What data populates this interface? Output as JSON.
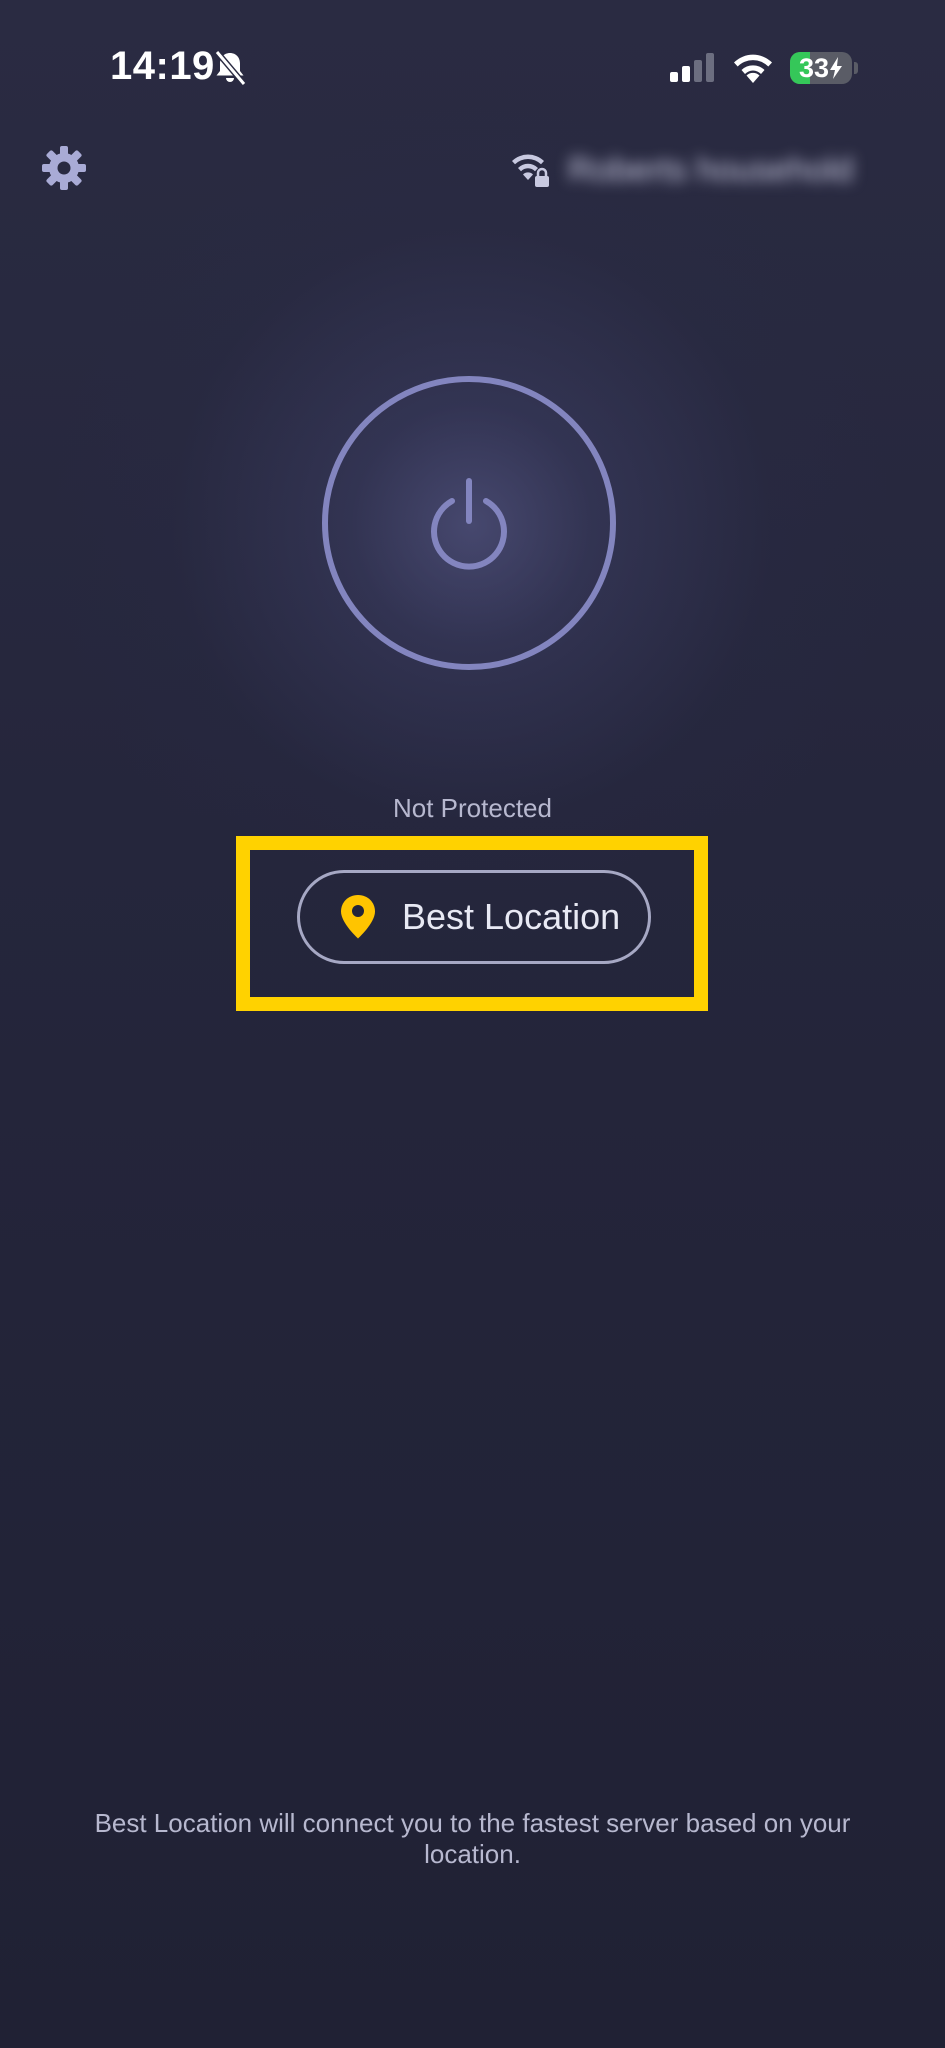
{
  "status_bar": {
    "time": "14:19",
    "battery_level": "33",
    "icons": [
      "bell-slash-icon",
      "cellular-signal-icon",
      "wifi-icon",
      "battery-charging-icon"
    ]
  },
  "header": {
    "settings_icon": "gear-icon",
    "network_icon": "wifi-lock-icon",
    "network_name": "Roberts household"
  },
  "main": {
    "power_icon": "power-icon",
    "status": "Not Protected",
    "location_button": {
      "icon": "map-pin-icon",
      "label": "Best Location"
    }
  },
  "footer": {
    "description": "Best Location will connect you to the fastest server based on your location."
  },
  "colors": {
    "background": "#23243a",
    "accent": "#8385bf",
    "highlight": "#ffd200",
    "pin": "#ffc400",
    "battery_fill": "#35c759"
  }
}
